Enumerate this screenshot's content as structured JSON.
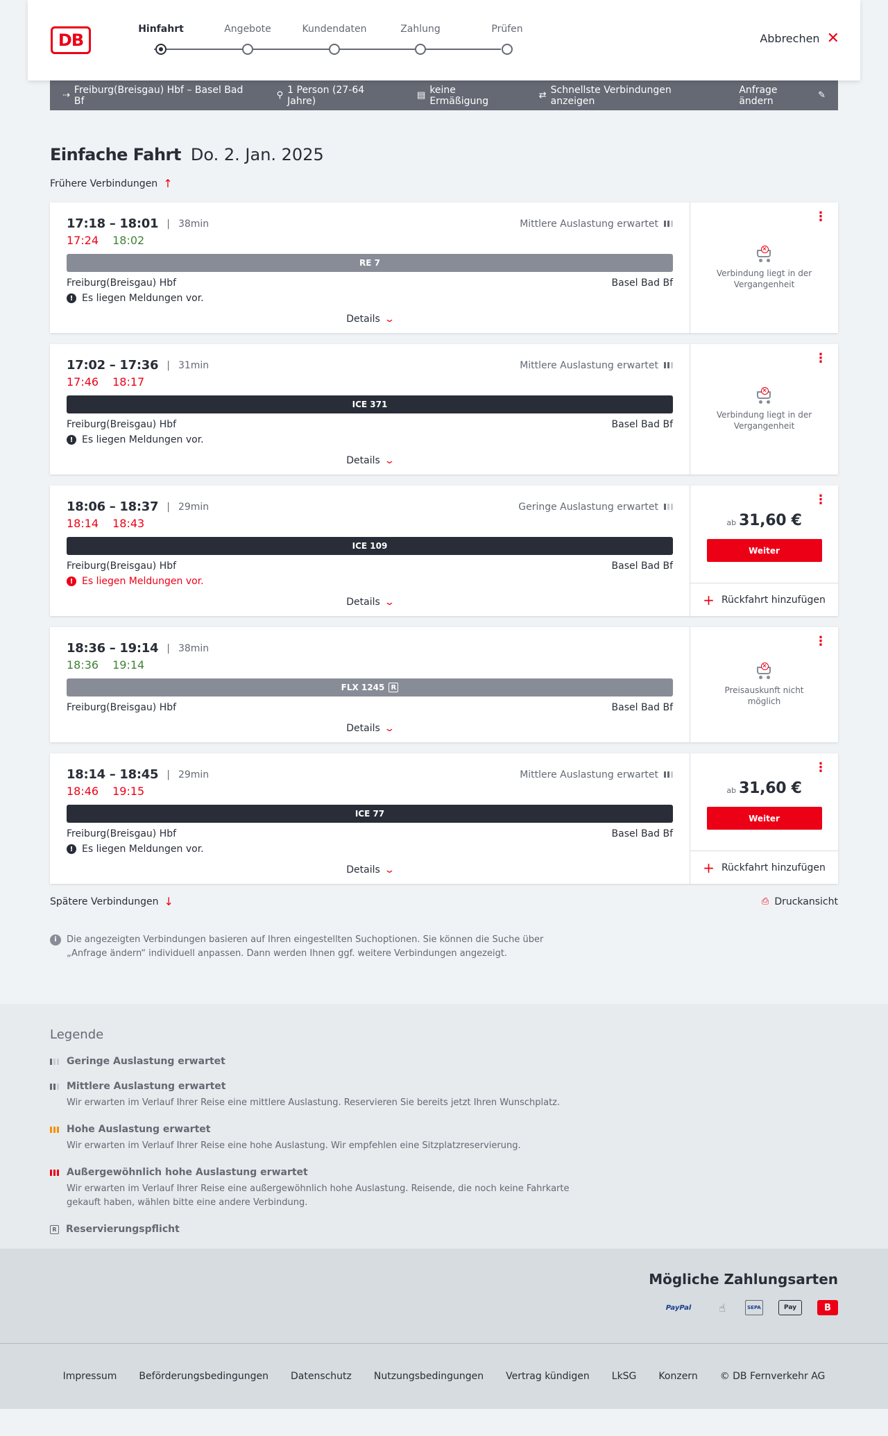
{
  "header": {
    "logo": "DB",
    "steps": [
      {
        "label": "Hinfahrt",
        "active": true
      },
      {
        "label": "Angebote",
        "active": false
      },
      {
        "label": "Kundendaten",
        "active": false
      },
      {
        "label": "Zahlung",
        "active": false
      },
      {
        "label": "Prüfen",
        "active": false
      }
    ],
    "cancel_label": "Abbrechen"
  },
  "searchbar": {
    "route": "Freiburg(Breisgau) Hbf – Basel Bad Bf",
    "passengers": "1 Person (27-64 Jahre)",
    "discount": "keine Ermäßigung",
    "fastest": "Schnellste Verbindungen anzeigen",
    "change": "Anfrage ändern"
  },
  "title": {
    "main": "Einfache Fahrt",
    "date": "Do. 2. Jan. 2025"
  },
  "earlier_label": "Frühere Verbindungen",
  "later_label": "Spätere Verbindungen",
  "print_label": "Druckansicht",
  "details_label": "Details",
  "connections": [
    {
      "times": "17:18 – 18:01",
      "duration": "38min",
      "load": "Mittlere Auslastung erwartet",
      "load_level": 2,
      "rt_dep": "17:24",
      "rt_dep_status": "late",
      "rt_arr": "18:02",
      "rt_arr_status": "ok",
      "train": "RE 7",
      "train_style": "gray",
      "reservation": false,
      "from": "Freiburg(Breisgau) Hbf",
      "to": "Basel Bad Bf",
      "message": "Es liegen Meldungen vor.",
      "message_style": "normal",
      "side": "na",
      "na_text": "Verbindung liegt in der Vergangenheit"
    },
    {
      "times": "17:02 – 17:36",
      "duration": "31min",
      "load": "Mittlere Auslastung erwartet",
      "load_level": 2,
      "rt_dep": "17:46",
      "rt_dep_status": "late",
      "rt_arr": "18:17",
      "rt_arr_status": "late",
      "train": "ICE 371",
      "train_style": "dark",
      "reservation": false,
      "from": "Freiburg(Breisgau) Hbf",
      "to": "Basel Bad Bf",
      "message": "Es liegen Meldungen vor.",
      "message_style": "normal",
      "side": "na",
      "na_text": "Verbindung liegt in der Vergangenheit"
    },
    {
      "times": "18:06 – 18:37",
      "duration": "29min",
      "load": "Geringe Auslastung erwartet",
      "load_level": 1,
      "rt_dep": "18:14",
      "rt_dep_status": "late",
      "rt_arr": "18:43",
      "rt_arr_status": "late",
      "train": "ICE 109",
      "train_style": "dark",
      "reservation": false,
      "from": "Freiburg(Breisgau) Hbf",
      "to": "Basel Bad Bf",
      "message": "Es liegen Meldungen vor.",
      "message_style": "red",
      "side": "price",
      "price_prefix": "ab",
      "price": "31,60 €",
      "button": "Weiter",
      "return_label": "Rückfahrt hinzufügen"
    },
    {
      "times": "18:36 – 19:14",
      "duration": "38min",
      "load": "",
      "load_level": 0,
      "rt_dep": "18:36",
      "rt_dep_status": "ok",
      "rt_arr": "19:14",
      "rt_arr_status": "ok",
      "train": "FLX 1245",
      "train_style": "gray",
      "reservation": true,
      "reservation_badge": "R",
      "from": "Freiburg(Breisgau) Hbf",
      "to": "Basel Bad Bf",
      "message": "",
      "message_style": "normal",
      "side": "na",
      "na_text": "Preisauskunft nicht möglich"
    },
    {
      "times": "18:14 – 18:45",
      "duration": "29min",
      "load": "Mittlere Auslastung erwartet",
      "load_level": 2,
      "rt_dep": "18:46",
      "rt_dep_status": "late",
      "rt_arr": "19:15",
      "rt_arr_status": "late",
      "train": "ICE 77",
      "train_style": "dark",
      "reservation": false,
      "from": "Freiburg(Breisgau) Hbf",
      "to": "Basel Bad Bf",
      "message": "Es liegen Meldungen vor.",
      "message_style": "normal",
      "side": "price",
      "price_prefix": "ab",
      "price": "31,60 €",
      "button": "Weiter",
      "return_label": "Rückfahrt hinzufügen"
    }
  ],
  "info_text": "Die angezeigten Verbindungen basieren auf Ihren eingestellten Suchoptionen. Sie können die Suche über „Anfrage ändern“ individuell anpassen. Dann werden Ihnen ggf. weitere Verbindungen angezeigt.",
  "legend": {
    "title": "Legende",
    "items": [
      {
        "icon": "low",
        "title": "Geringe Auslastung erwartet",
        "desc": ""
      },
      {
        "icon": "medium",
        "title": "Mittlere Auslastung erwartet",
        "desc": "Wir erwarten im Verlauf Ihrer Reise eine mittlere Auslastung. Reservieren Sie bereits jetzt Ihren Wunschplatz."
      },
      {
        "icon": "high",
        "title": "Hohe Auslastung erwartet",
        "desc": "Wir erwarten im Verlauf Ihrer Reise eine hohe Auslastung. Wir empfehlen eine Sitzplatzreservierung."
      },
      {
        "icon": "extreme",
        "title": "Außergewöhnlich hohe Auslastung erwartet",
        "desc": "Wir erwarten im Verlauf Ihrer Reise eine außergewöhnlich hohe Auslastung. Reisende, die noch keine Fahrkarte gekauft haben, wählen bitte eine andere Verbindung."
      },
      {
        "icon": "reservation",
        "title": "Reservierungspflicht",
        "desc": ""
      }
    ]
  },
  "payment": {
    "title": "Mögliche Zahlungsarten",
    "methods": [
      {
        "name": "paypal-icon",
        "text": "PayPal"
      },
      {
        "name": "credit-card-icon",
        "text": "☝"
      },
      {
        "name": "sepa-icon",
        "text": "SEPA"
      },
      {
        "name": "apple-pay-icon",
        "text": "Pay"
      },
      {
        "name": "db-bahn-icon",
        "text": "B"
      }
    ]
  },
  "footer": {
    "links": [
      "Impressum",
      "Beförderungsbedingungen",
      "Datenschutz",
      "Nutzungsbedingungen",
      "Vertrag kündigen",
      "LkSG",
      "Konzern",
      "© DB Fernverkehr AG"
    ]
  },
  "colors": {
    "accent": "#ec0016",
    "dark": "#282d37",
    "gray": "#646973",
    "ok": "#408335"
  }
}
